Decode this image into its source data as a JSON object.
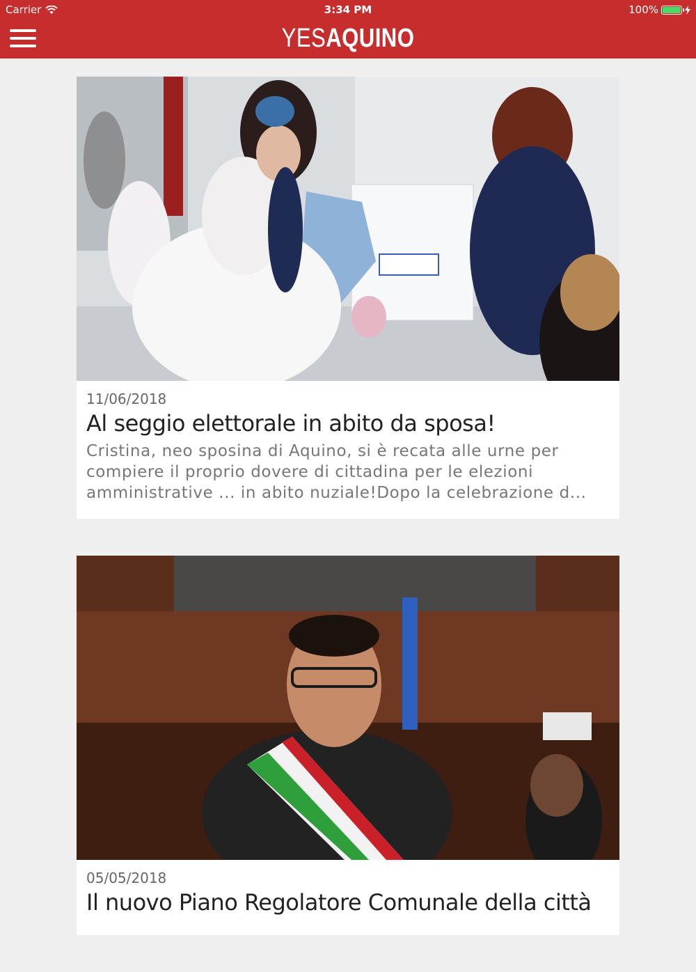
{
  "status_bar": {
    "carrier": "Carrier",
    "time": "3:34 PM",
    "battery": "100%",
    "battery_level": 1.0
  },
  "header": {
    "logo_part1": "YES",
    "logo_part2": "AQUINO",
    "menu_icon": "hamburger-menu-icon",
    "background_color": "#c62d2d"
  },
  "articles": [
    {
      "date": "11/06/2018",
      "title": "Al seggio elettorale in abito da sposa!",
      "excerpt": "Cristina, neo sposina di Aquino, si è recata alle urne per compiere il proprio dovere di cittadina per le elezioni amministrative ... in abito nuziale!Dopo la celebrazione d..."
    },
    {
      "date": "05/05/2018",
      "title": "Il nuovo Piano Regolatore Comunale della città",
      "excerpt": ""
    }
  ]
}
